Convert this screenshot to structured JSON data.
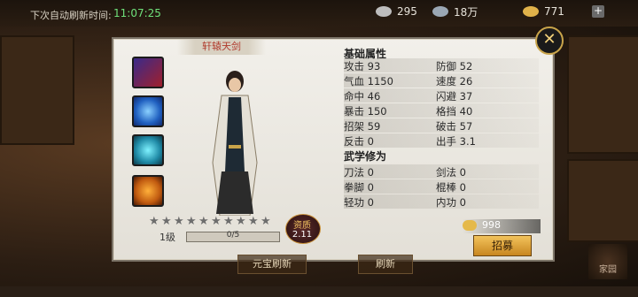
{
  "topbar": {
    "refresh_label": "下次自动刷新时间:",
    "refresh_time": "11:07:25",
    "resources": [
      {
        "icon": "silver-icon",
        "value": "295"
      },
      {
        "icon": "rice-icon",
        "value": "18万"
      },
      {
        "icon": "ingot-icon",
        "value": "771"
      }
    ],
    "plus": "+"
  },
  "hero": {
    "name": "轩辕天剑",
    "level": "1级",
    "exp": "0/5",
    "stars_total": 10,
    "stars_filled": 0,
    "aptitude_label": "资质",
    "aptitude_value": "2.11"
  },
  "skills": [
    "blade-skill-icon",
    "shield-skill-icon",
    "wind-skill-icon",
    "fire-skill-icon"
  ],
  "attributes": {
    "title": "基础属性",
    "rows": [
      {
        "l": "攻击 93",
        "r": "防御 52"
      },
      {
        "l": "气血 1150",
        "r": "速度 26"
      },
      {
        "l": "命中 46",
        "r": "闪避 37"
      },
      {
        "l": "暴击 150",
        "r": "格挡 40"
      },
      {
        "l": "招架 59",
        "r": "破击 57"
      },
      {
        "l": "反击 0",
        "r": "出手 3.1"
      }
    ]
  },
  "martial": {
    "title": "武学修为",
    "rows": [
      {
        "l": "刀法 0",
        "r": "剑法 0"
      },
      {
        "l": "拳脚 0",
        "r": "棍棒 0"
      },
      {
        "l": "轻功 0",
        "r": "内功 0"
      }
    ]
  },
  "cost": {
    "value": "998"
  },
  "recruit_label": "招募",
  "bottom": {
    "ingot_refresh": "元宝刷新",
    "refresh": "刷新",
    "family": "家园"
  },
  "close": "✕"
}
